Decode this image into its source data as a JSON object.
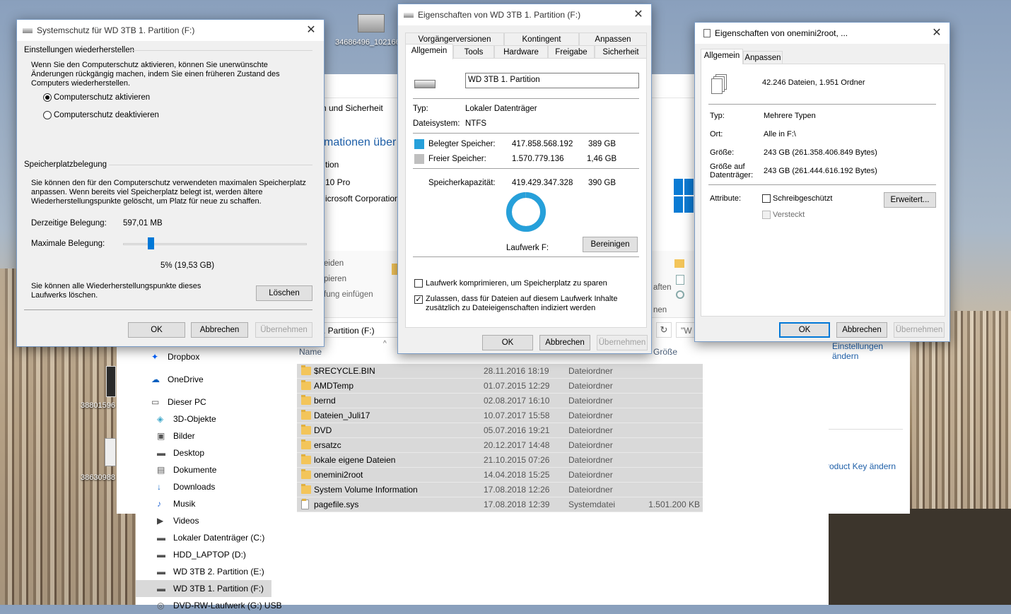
{
  "desktop": {
    "icon_labels": [
      "34686496_102166",
      "38801596",
      "38630988"
    ]
  },
  "explorer": {
    "frag_system": "n und Sicherheit",
    "frag_info": "mationen über",
    "frag_tion": "tion",
    "frag_win": "10 Pro",
    "frag_corp": "icrosoft Corporation",
    "ribbon_frags": [
      "eiden",
      "pieren",
      "fung einfügen",
      "aften",
      "nen"
    ],
    "address": ". Partition (F:)",
    "search": "\"W",
    "col_name": "Name",
    "col_size": "Größe",
    "right_links": [
      "Einstellungen ändern",
      "roduct Key ändern"
    ],
    "nav": [
      {
        "label": "Dropbox",
        "icon": "dropbox-icon"
      },
      {
        "label": "OneDrive",
        "icon": "onedrive-icon"
      },
      {
        "label": "Dieser PC",
        "icon": "pc-icon"
      },
      {
        "label": "3D-Objekte",
        "icon": "cube-icon"
      },
      {
        "label": "Bilder",
        "icon": "image-icon"
      },
      {
        "label": "Desktop",
        "icon": "desktop-icon"
      },
      {
        "label": "Dokumente",
        "icon": "document-icon"
      },
      {
        "label": "Downloads",
        "icon": "download-icon"
      },
      {
        "label": "Musik",
        "icon": "music-icon"
      },
      {
        "label": "Videos",
        "icon": "video-icon"
      },
      {
        "label": "Lokaler Datenträger (C:)",
        "icon": "drive-icon"
      },
      {
        "label": "HDD_LAPTOP (D:)",
        "icon": "drive-icon"
      },
      {
        "label": "WD 3TB 2. Partition (E:)",
        "icon": "drive-icon"
      },
      {
        "label": "WD 3TB 1. Partition (F:)",
        "icon": "drive-icon"
      },
      {
        "label": "DVD-RW-Laufwerk (G:) USB",
        "icon": "dvd-icon"
      }
    ],
    "files": [
      {
        "name": "$RECYCLE.BIN",
        "date": "28.11.2016 18:19",
        "type": "Dateiordner",
        "size": ""
      },
      {
        "name": "AMDTemp",
        "date": "01.07.2015 12:29",
        "type": "Dateiordner",
        "size": ""
      },
      {
        "name": "bernd",
        "date": "02.08.2017 16:10",
        "type": "Dateiordner",
        "size": ""
      },
      {
        "name": "Dateien_Juli17",
        "date": "10.07.2017 15:58",
        "type": "Dateiordner",
        "size": ""
      },
      {
        "name": "DVD",
        "date": "05.07.2016 19:21",
        "type": "Dateiordner",
        "size": ""
      },
      {
        "name": "ersatzc",
        "date": "20.12.2017 14:48",
        "type": "Dateiordner",
        "size": ""
      },
      {
        "name": "lokale eigene Dateien",
        "date": "21.10.2015 07:26",
        "type": "Dateiordner",
        "size": ""
      },
      {
        "name": "onemini2root",
        "date": "14.04.2018 15:25",
        "type": "Dateiordner",
        "size": ""
      },
      {
        "name": "System Volume Information",
        "date": "17.08.2018 12:26",
        "type": "Dateiordner",
        "size": ""
      },
      {
        "name": "pagefile.sys",
        "date": "17.08.2018 12:39",
        "type": "Systemdatei",
        "size": "1.501.200 KB"
      }
    ]
  },
  "sysprot": {
    "title": "Systemschutz für WD 3TB 1. Partition (F:)",
    "restore_header": "Einstellungen wiederherstellen",
    "restore_text": "Wenn Sie den Computerschutz aktivieren, können Sie unerwünschte Änderungen rückgängig machen, indem Sie einen früheren Zustand des Computers wiederherstellen.",
    "radio_on": "Computerschutz aktivieren",
    "radio_off": "Computerschutz deaktivieren",
    "space_header": "Speicherplatzbelegung",
    "space_text": "Sie können den für den Computerschutz verwendeten maximalen Speicherplatz anpassen. Wenn bereits viel Speicherplatz belegt ist, werden ältere Wiederherstellungspunkte gelöscht, um Platz für neue zu schaffen.",
    "current_label": "Derzeitige Belegung:",
    "current_value": "597,01 MB",
    "max_label": "Maximale Belegung:",
    "slider_fraction": 0.05,
    "slider_value": "5% (19,53 GB)",
    "delete_text": "Sie können alle Wiederherstellungspunkte dieses Laufwerks löschen.",
    "delete_btn": "Löschen",
    "ok": "OK",
    "cancel": "Abbrechen",
    "apply": "Übernehmen"
  },
  "drive_props": {
    "title": "Eigenschaften von WD 3TB 1. Partition (F:)",
    "tabs_row1": [
      "Vorgängerversionen",
      "Kontingent",
      "Anpassen"
    ],
    "tabs_row2": [
      "Allgemein",
      "Tools",
      "Hardware",
      "Freigabe",
      "Sicherheit"
    ],
    "name_value": "WD 3TB 1. Partition",
    "type_label": "Typ:",
    "type_value": "Lokaler Datenträger",
    "fs_label": "Dateisystem:",
    "fs_value": "NTFS",
    "used_label": "Belegter Speicher:",
    "used_bytes": "417.858.568.192",
    "used_gb": "389 GB",
    "free_label": "Freier Speicher:",
    "free_bytes": "1.570.779.136",
    "free_gb": "1,46 GB",
    "cap_label": "Speicherkapazität:",
    "cap_bytes": "419.429.347.328",
    "cap_gb": "390 GB",
    "used_fraction": 0.9963,
    "used_color": "#26a0da",
    "free_color": "#bfbfbf",
    "drive_label": "Laufwerk F:",
    "cleanup_btn": "Bereinigen",
    "compress_label": "Laufwerk komprimieren, um Speicherplatz zu sparen",
    "index_label": "Zulassen, dass für Dateien auf diesem Laufwerk Inhalte zusätzlich zu Dateieigenschaften indiziert werden",
    "ok": "OK",
    "cancel": "Abbrechen",
    "apply": "Übernehmen"
  },
  "multi_props": {
    "title": "Eigenschaften von onemini2root, ...",
    "tabs": [
      "Allgemein",
      "Anpassen"
    ],
    "summary": "42.246 Dateien, 1.951 Ordner",
    "type_label": "Typ:",
    "type_value": "Mehrere Typen",
    "loc_label": "Ort:",
    "loc_value": "Alle in F:\\",
    "size_label": "Größe:",
    "size_value": "243 GB (261.358.406.849 Bytes)",
    "disk_label": "Größe auf Datenträger:",
    "disk_value": "243 GB (261.444.616.192 Bytes)",
    "attr_label": "Attribute:",
    "readonly_label": "Schreibgeschützt",
    "hidden_label": "Versteckt",
    "advanced_btn": "Erweitert...",
    "ok": "OK",
    "cancel": "Abbrechen",
    "apply": "Übernehmen"
  }
}
